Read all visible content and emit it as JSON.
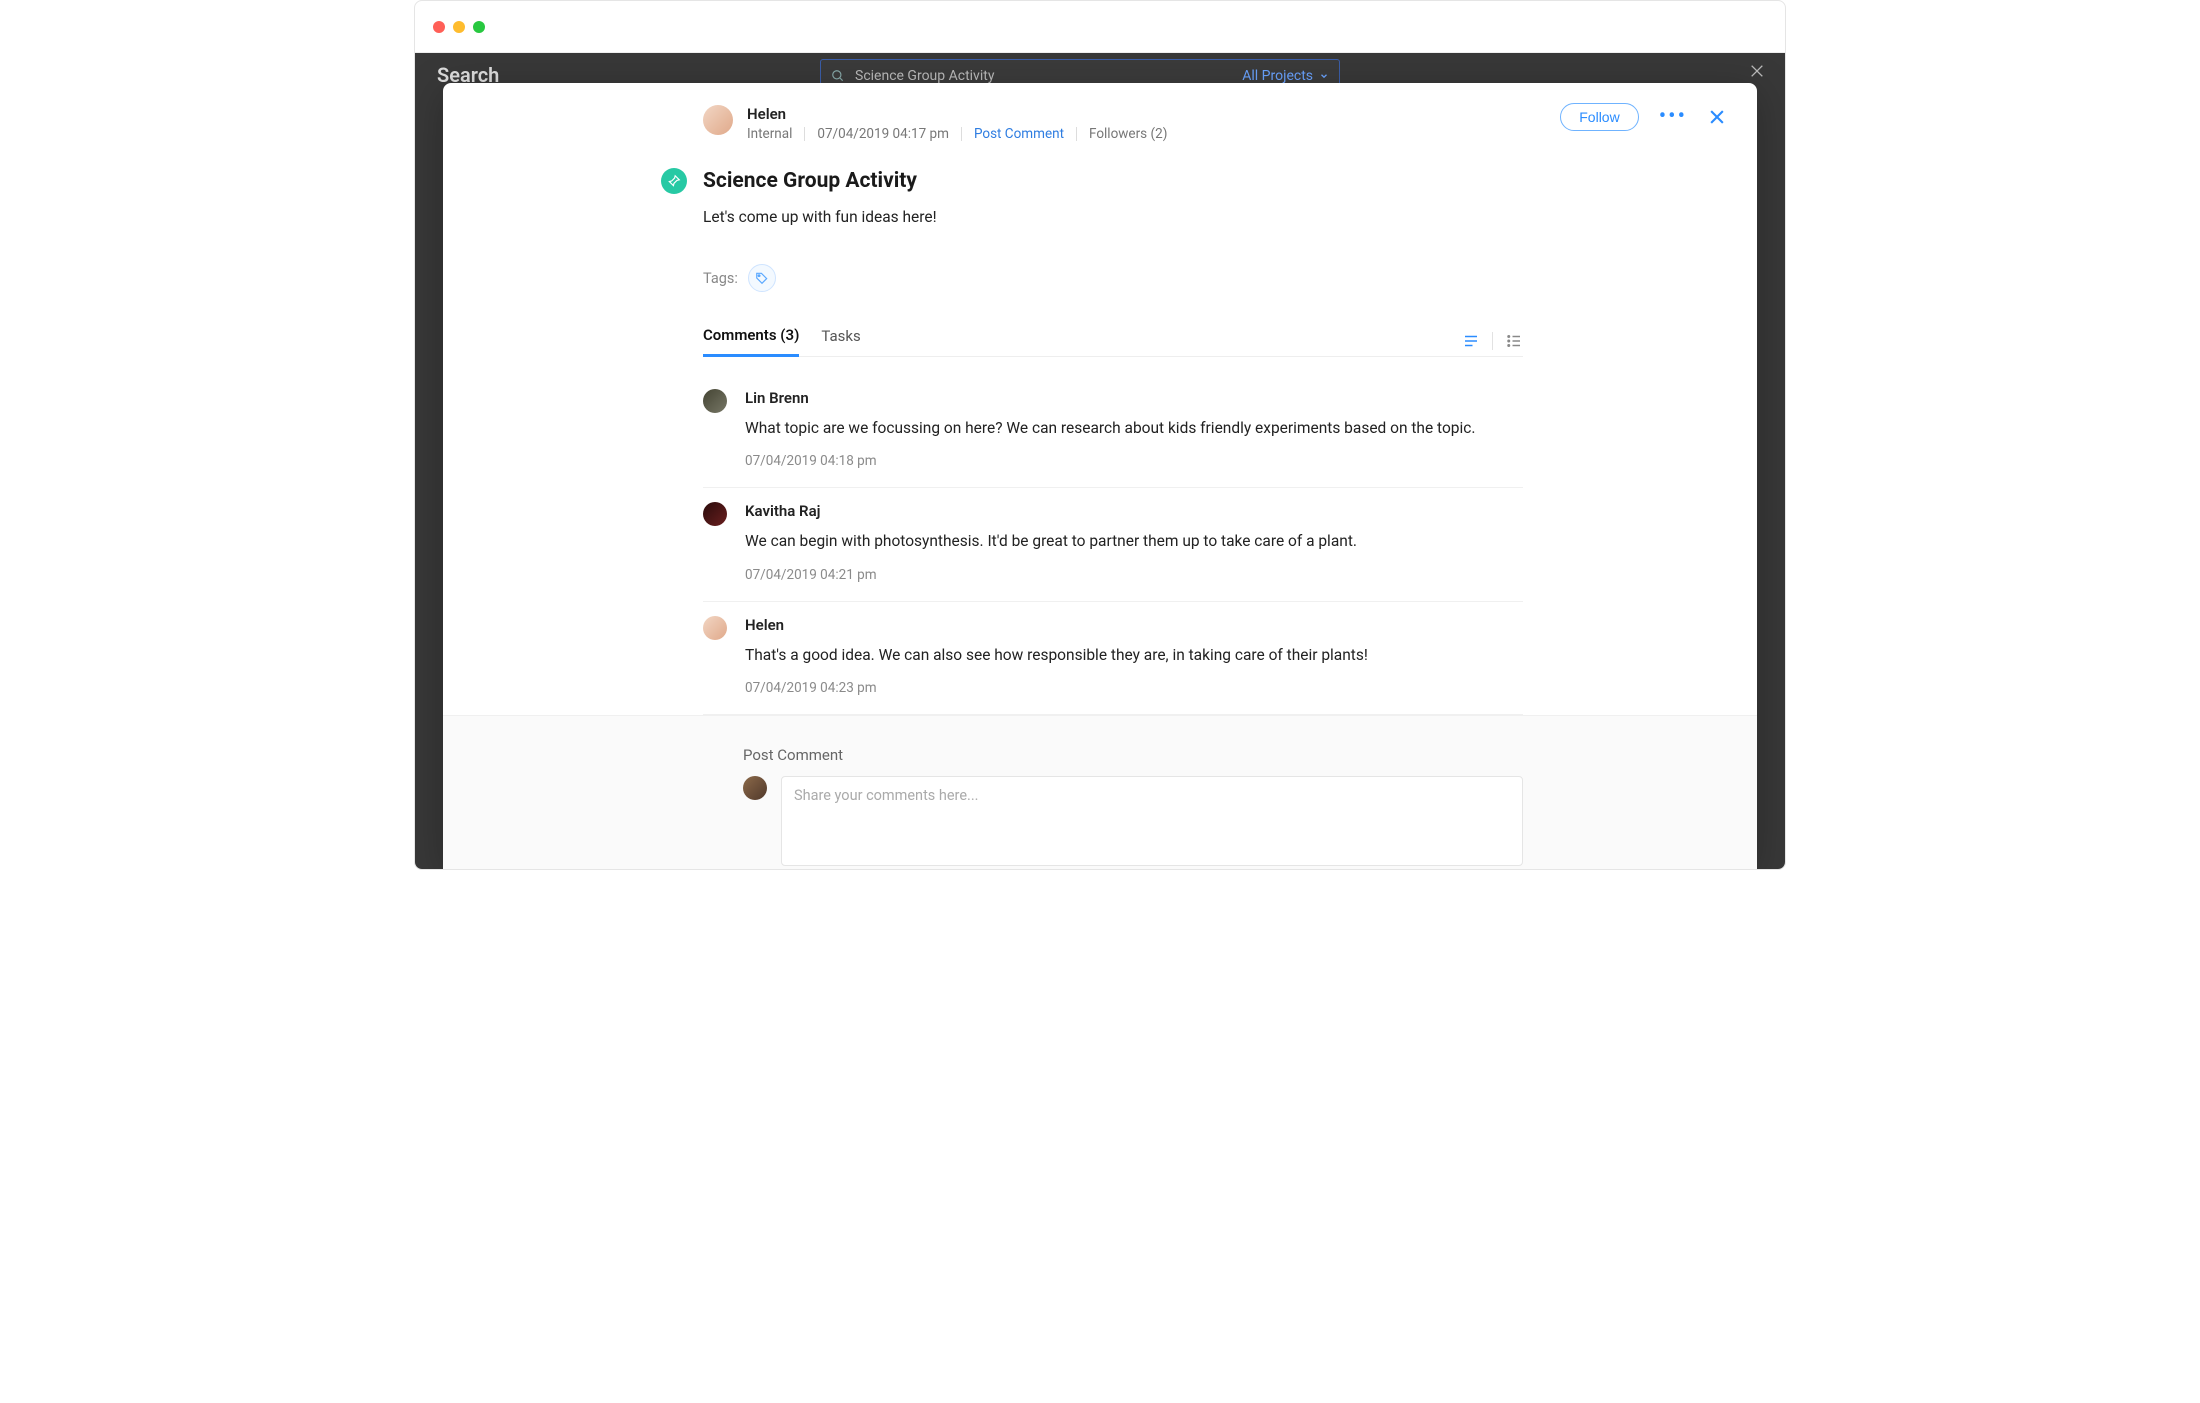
{
  "bg": {
    "search_label": "Search",
    "search_value": "Science Group Activity",
    "project_filter": "All Projects"
  },
  "post": {
    "author": "Helen",
    "visibility": "Internal",
    "timestamp": "07/04/2019 04:17 pm",
    "post_comment_link": "Post Comment",
    "followers_label": "Followers (2)",
    "title": "Science Group Activity",
    "description": "Let's come up with fun ideas here!",
    "tags_label": "Tags:"
  },
  "actions": {
    "follow_label": "Follow"
  },
  "tabs": {
    "comments": "Comments (3)",
    "tasks": "Tasks"
  },
  "comments": [
    {
      "author": "Lin Brenn",
      "avatar": "lin",
      "text": "What topic are we focussing on here? We can research about kids friendly experiments based on the topic.",
      "time": "07/04/2019 04:18 pm"
    },
    {
      "author": "Kavitha Raj",
      "avatar": "kavitha",
      "text": "We can begin with photosynthesis. It'd be great to partner them up to take care of a plant.",
      "time": "07/04/2019 04:21 pm"
    },
    {
      "author": "Helen",
      "avatar": "helen",
      "text": "That's a good idea. We can also see how responsible they are, in taking care of their plants!",
      "time": "07/04/2019 04:23 pm"
    }
  ],
  "compose": {
    "label": "Post Comment",
    "placeholder": "Share your comments here..."
  }
}
